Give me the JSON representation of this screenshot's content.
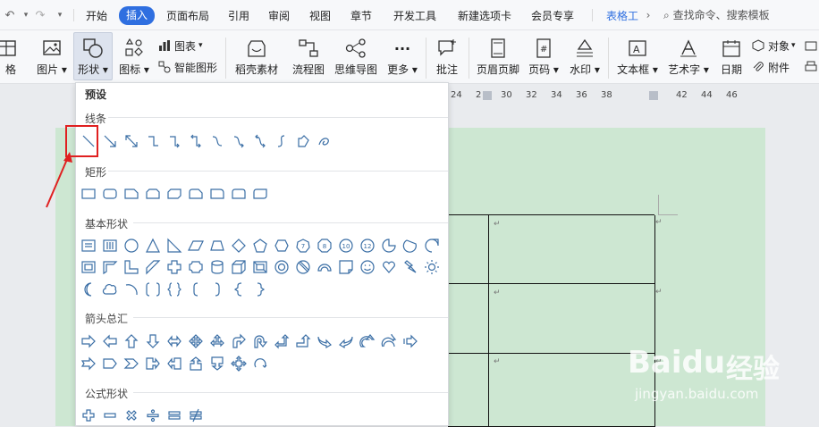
{
  "menu": {
    "items": [
      "开始",
      "插入",
      "页面布局",
      "引用",
      "审阅",
      "视图",
      "章节",
      "开发工具",
      "新建选项卡",
      "会员专享"
    ],
    "active": "插入",
    "table_tools": "表格工",
    "search_placeholder": "查找命令、搜索模板"
  },
  "ribbon": {
    "table_partial": "格",
    "picture": "图片",
    "shapes": "形状",
    "icons": "图标",
    "chart": "图表",
    "smart_art": "智能图形",
    "materials": "稻壳素材",
    "flowchart": "流程图",
    "mindmap": "思维导图",
    "more": "更多",
    "comment": "批注",
    "header_footer": "页眉页脚",
    "page_number": "页码",
    "watermark": "水印",
    "text_box": "文本框",
    "word_art": "艺术字",
    "date": "日期",
    "object": "对象",
    "attachment": "附件"
  },
  "ruler": {
    "ticks": [
      "24",
      "2",
      "30",
      "32",
      "34",
      "36",
      "38",
      "42",
      "44",
      "46"
    ]
  },
  "dropdown": {
    "title": "预设",
    "sections": {
      "lines": "线条",
      "rect": "矩形",
      "basic": "基本形状",
      "arrows": "箭头总汇",
      "formula": "公式形状"
    },
    "basic_labels": {
      "oct": "7",
      "dec": "10",
      "dod": "12",
      "hex": "8"
    }
  },
  "watermark": {
    "brand": "Baidu",
    "brand_cn": "经验",
    "url": "jingyan.baidu.com"
  },
  "colors": {
    "accent": "#2f6fe0",
    "highlight": "#e02020",
    "page": "#cde7d2"
  }
}
